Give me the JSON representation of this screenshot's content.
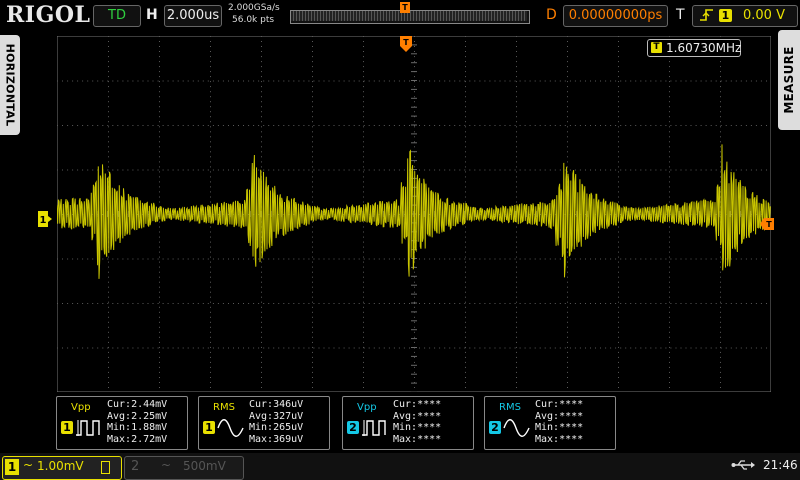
{
  "brand": "RIGOL",
  "status": "TD",
  "horizontal": {
    "label": "H",
    "timebase": "2.000us",
    "sample_rate": "2.000GSa/s",
    "memory_depth": "56.0k pts"
  },
  "delay": {
    "label": "D",
    "value": "0.00000000ps"
  },
  "trigger": {
    "label": "T",
    "source": "1",
    "level": "0.00 V",
    "edge_icon": "rising-edge-icon"
  },
  "side_tabs": {
    "horizontal": "HORIZONTAL",
    "measure": "MEASURE"
  },
  "frequency_readout": {
    "badge": "T",
    "value": "1.60730MHz"
  },
  "markers": {
    "channel1": "1",
    "trigger_position": "T",
    "trigger_level": "T"
  },
  "measurements": [
    {
      "name": "Vpp",
      "channel": "1",
      "color": "#e8e000",
      "lines": [
        "Cur:2.44mV",
        "Avg:2.25mV",
        "Min:1.88mV",
        "Max:2.72mV"
      ]
    },
    {
      "name": "RMS",
      "channel": "1",
      "color": "#e8e000",
      "lines": [
        "Cur:346uV",
        "Avg:327uV",
        "Min:265uV",
        "Max:369uV"
      ]
    },
    {
      "name": "Vpp",
      "channel": "2",
      "color": "#14c8e6",
      "lines": [
        "Cur:****",
        "Avg:****",
        "Min:****",
        "Max:****"
      ]
    },
    {
      "name": "RMS",
      "channel": "2",
      "color": "#14c8e6",
      "lines": [
        "Cur:****",
        "Avg:****",
        "Min:****",
        "Max:****"
      ]
    }
  ],
  "channels": [
    {
      "number": "1",
      "coupling": "~",
      "scale": "1.00mV",
      "active": true,
      "color": "#e8e000"
    },
    {
      "number": "2",
      "coupling": "~",
      "scale": "500mV",
      "active": false,
      "color": "#555555"
    }
  ],
  "system": {
    "usb_icon": "usb-icon",
    "time": "21:46"
  }
}
